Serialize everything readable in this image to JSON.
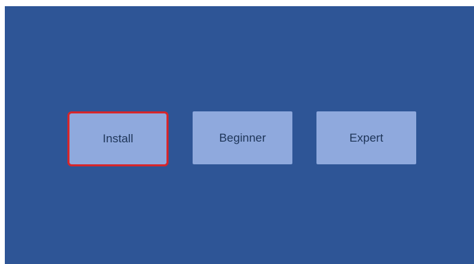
{
  "menu": {
    "buttons": [
      {
        "label": "Install",
        "selected": true
      },
      {
        "label": "Beginner",
        "selected": false
      },
      {
        "label": "Expert",
        "selected": false
      }
    ]
  },
  "colors": {
    "background": "#2e5596",
    "button": "#8fa9dd",
    "button_text": "#1e3558",
    "selection_border": "#d6262b"
  }
}
